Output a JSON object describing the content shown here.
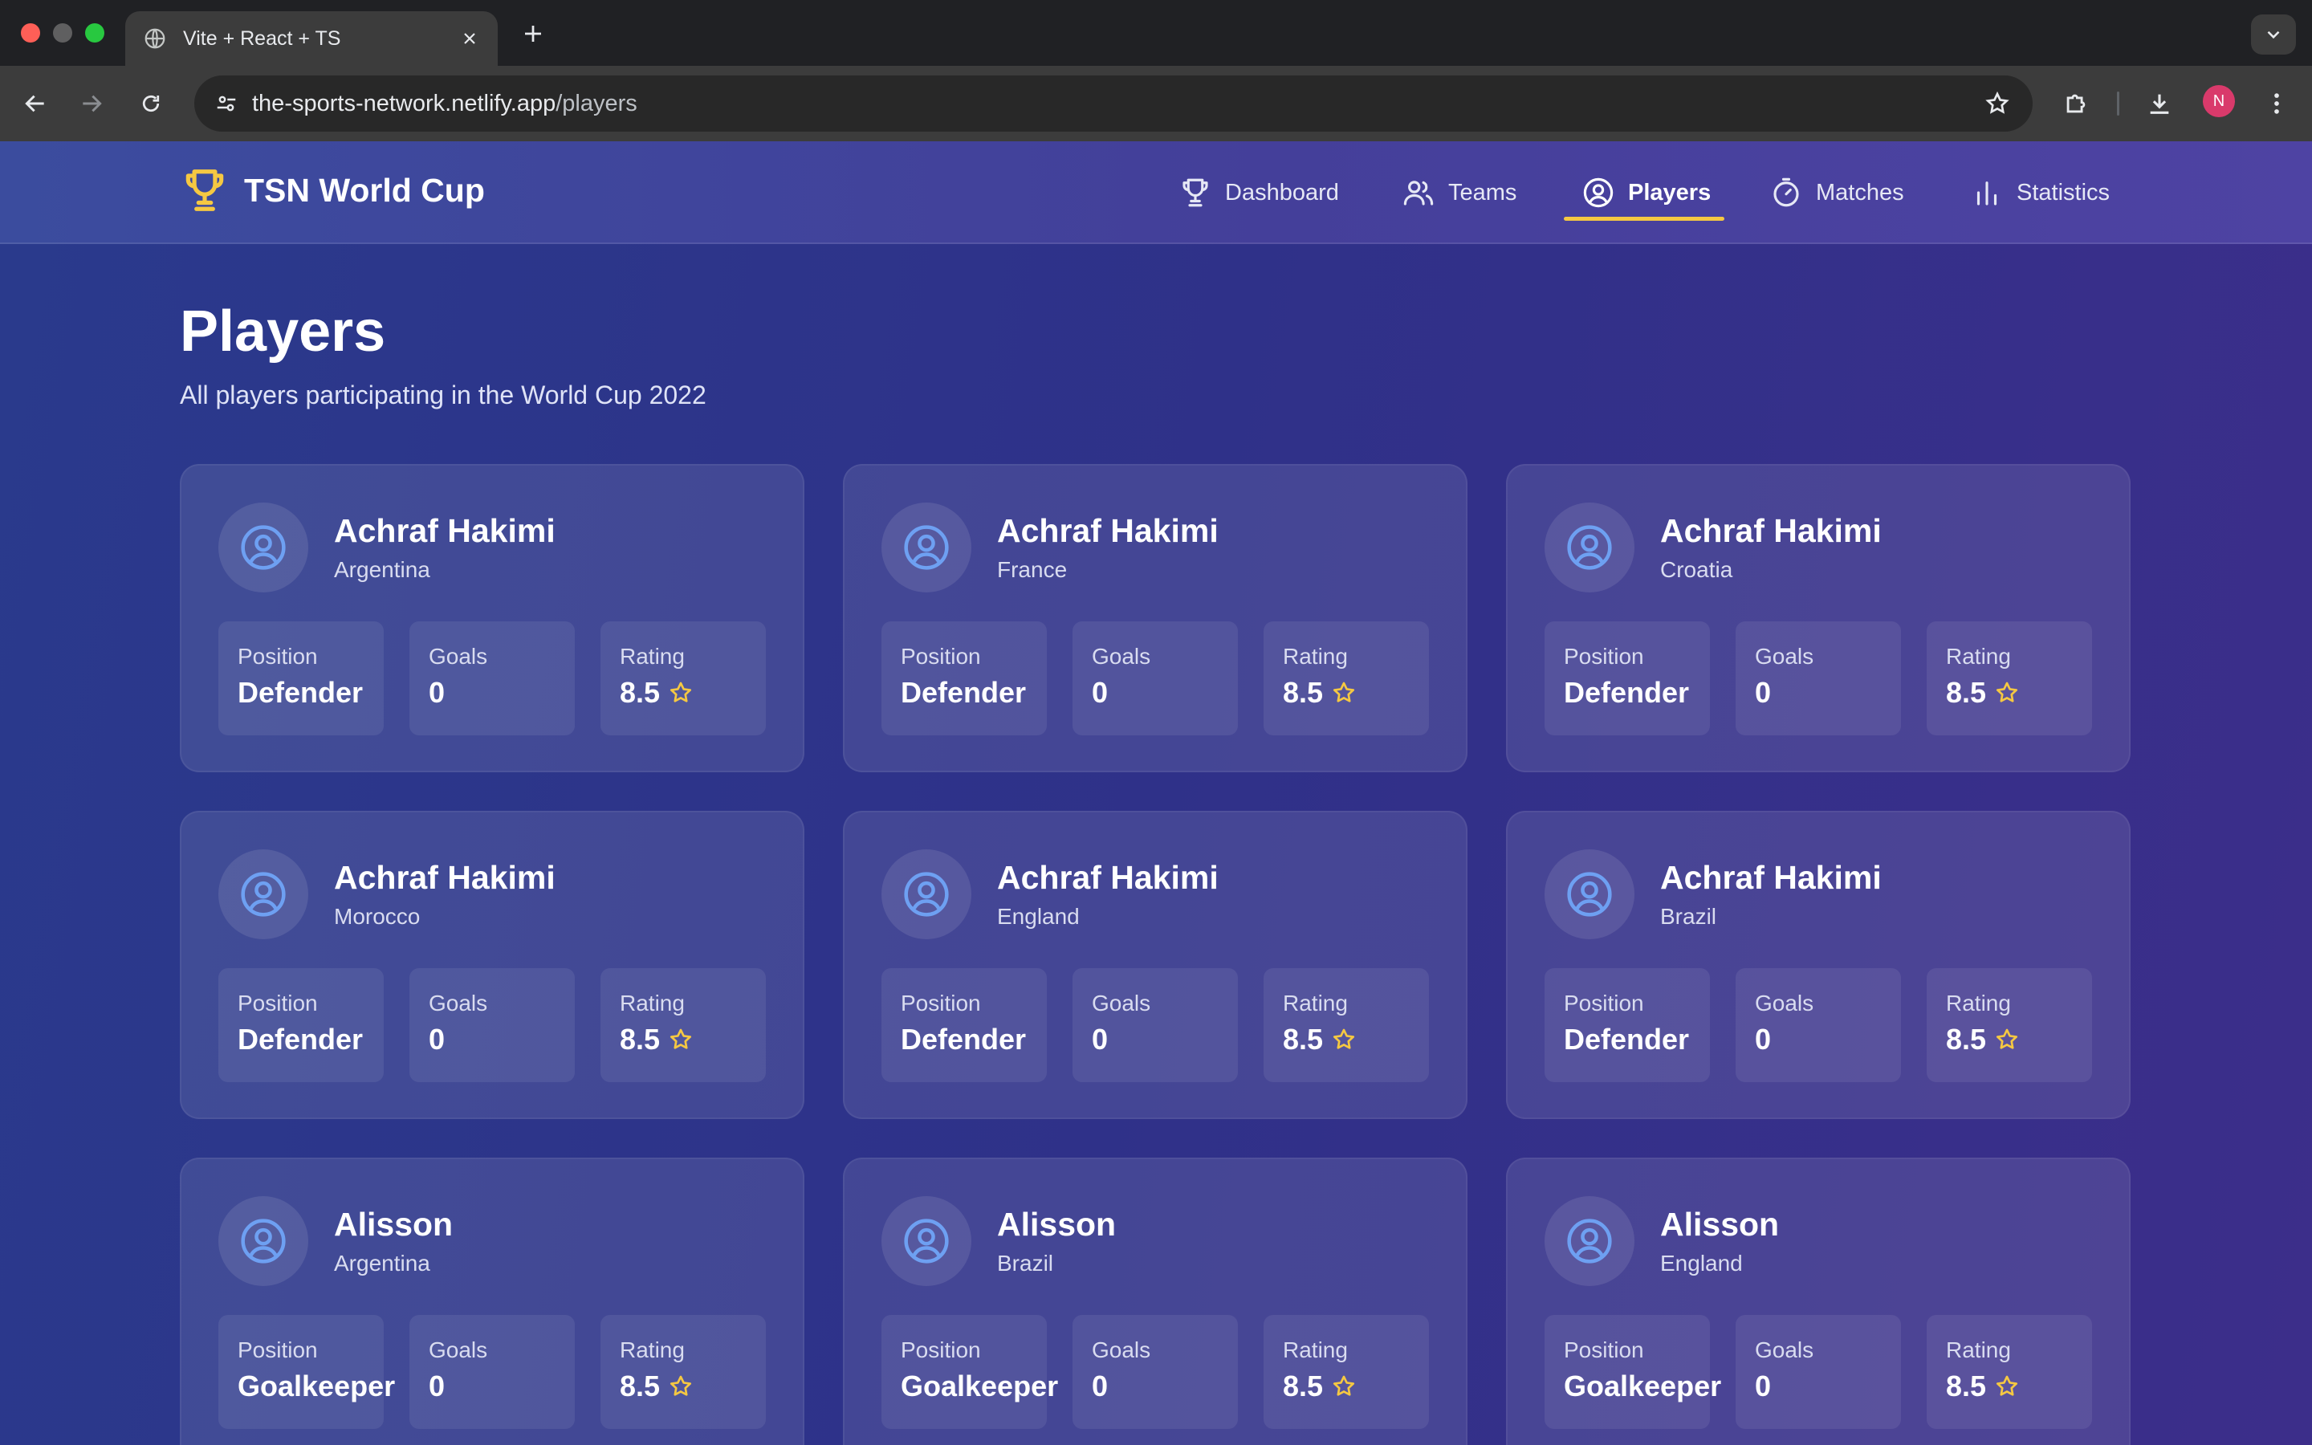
{
  "browser": {
    "tab_title": "Vite + React + TS",
    "url_host": "the-sports-network.netlify.app",
    "url_path": "/players",
    "profile_initial": "N"
  },
  "app": {
    "brand": "TSN World Cup",
    "nav": [
      {
        "label": "Dashboard",
        "icon": "trophy-icon"
      },
      {
        "label": "Teams",
        "icon": "users-icon"
      },
      {
        "label": "Players",
        "icon": "user-circle-icon",
        "active": true
      },
      {
        "label": "Matches",
        "icon": "timer-icon"
      },
      {
        "label": "Statistics",
        "icon": "bar-chart-icon"
      }
    ],
    "accent_color": "#f5c842"
  },
  "page": {
    "title": "Players",
    "subtitle": "All players participating in the World Cup 2022"
  },
  "stat_labels": {
    "position": "Position",
    "goals": "Goals",
    "rating": "Rating"
  },
  "players": [
    {
      "name": "Achraf Hakimi",
      "team": "Argentina",
      "position": "Defender",
      "goals": "0",
      "rating": "8.5"
    },
    {
      "name": "Achraf Hakimi",
      "team": "France",
      "position": "Defender",
      "goals": "0",
      "rating": "8.5"
    },
    {
      "name": "Achraf Hakimi",
      "team": "Croatia",
      "position": "Defender",
      "goals": "0",
      "rating": "8.5"
    },
    {
      "name": "Achraf Hakimi",
      "team": "Morocco",
      "position": "Defender",
      "goals": "0",
      "rating": "8.5"
    },
    {
      "name": "Achraf Hakimi",
      "team": "England",
      "position": "Defender",
      "goals": "0",
      "rating": "8.5"
    },
    {
      "name": "Achraf Hakimi",
      "team": "Brazil",
      "position": "Defender",
      "goals": "0",
      "rating": "8.5"
    },
    {
      "name": "Alisson",
      "team": "Argentina",
      "position": "Goalkeeper",
      "goals": "0",
      "rating": "8.5"
    },
    {
      "name": "Alisson",
      "team": "Brazil",
      "position": "Goalkeeper",
      "goals": "0",
      "rating": "8.5"
    },
    {
      "name": "Alisson",
      "team": "England",
      "position": "Goalkeeper",
      "goals": "0",
      "rating": "8.5"
    }
  ]
}
